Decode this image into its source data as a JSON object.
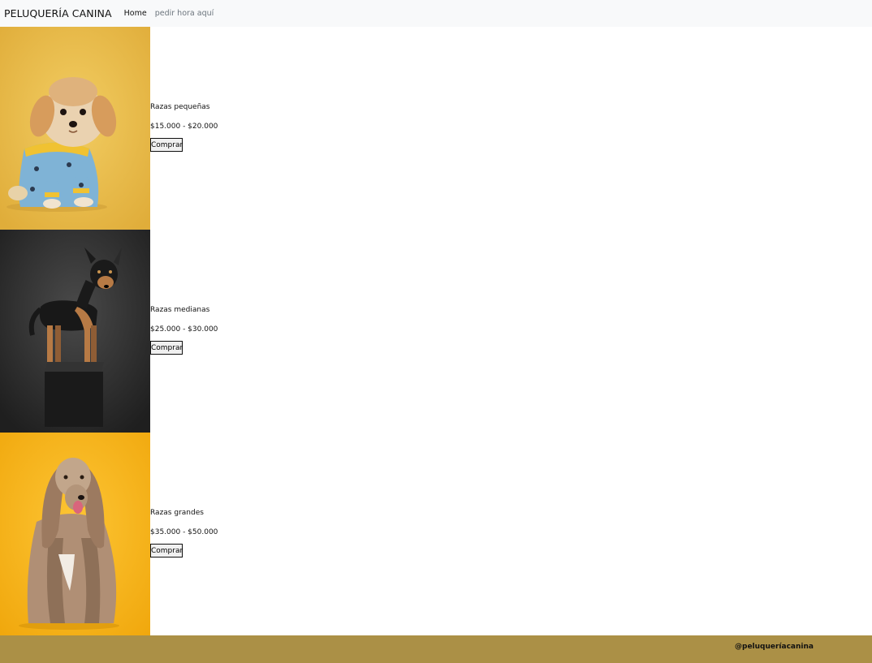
{
  "navbar": {
    "brand": "PELUQUERÍA CANINA",
    "links": [
      {
        "label": "Home"
      },
      {
        "label": "pedir hora aquí"
      }
    ]
  },
  "products": [
    {
      "name": "Razas pequeñas",
      "price": "$15.000 - $20.000",
      "button": "Comprar",
      "image_icon": "small-dog-photo",
      "background": "#ecc04e"
    },
    {
      "name": "Razas medianas",
      "price": "$25.000 - $30.000",
      "button": "Comprar",
      "image_icon": "medium-dog-photo",
      "background": "#2b2b2b"
    },
    {
      "name": "Razas grandes",
      "price": "$35.000 - $50.000",
      "button": "Comprar",
      "image_icon": "large-dog-photo",
      "background": "#f7b515"
    }
  ],
  "footer": {
    "handle": "@peluqueríacanina",
    "background": "#ab9046"
  }
}
